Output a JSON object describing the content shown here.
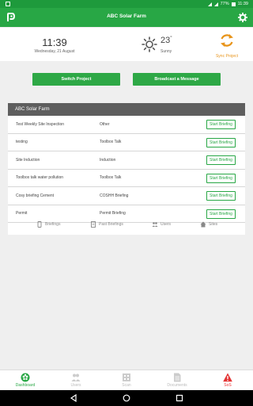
{
  "status_bar": {
    "left_icon": "app-notification-icon",
    "battery": "77%",
    "clock": "11:39"
  },
  "app_bar": {
    "title": "ABC Solar Farm",
    "logo_icon": "p-logo-icon",
    "settings_icon": "gear-icon"
  },
  "header": {
    "time": "11:39",
    "date": "Wednesday, 21 August",
    "temperature": "23",
    "temperature_unit": "°",
    "condition": "Sunny",
    "sync_label": "Sync Project",
    "weather_icon": "sun-icon",
    "sync_icon": "sync-icon"
  },
  "actions": {
    "switch_project": "Switch Project",
    "broadcast_message": "Broadcast a Message"
  },
  "panel": {
    "title": "ABC Solar Farm",
    "rows": [
      {
        "name": "Test Weekly Site Inspection",
        "type": "Other",
        "action": "Start Briefing"
      },
      {
        "name": "testing",
        "type": "Toolbox Talk",
        "action": "Start Briefing"
      },
      {
        "name": "Site Induction",
        "type": "Induction",
        "action": "Start Briefing"
      },
      {
        "name": "Toolbox talk water pollution",
        "type": "Toolbox Talk",
        "action": "Start Briefing"
      },
      {
        "name": "Cosy briefing Cement",
        "type": "COSHH Briefing",
        "action": "Start Briefing"
      },
      {
        "name": "Permit",
        "type": "Permit Briefing",
        "action": "Start Briefing"
      }
    ],
    "tabs": [
      {
        "label": "Briefings",
        "icon": "phone-icon"
      },
      {
        "label": "Past Briefings",
        "icon": "document-icon"
      },
      {
        "label": "Users",
        "icon": "users-icon"
      },
      {
        "label": "Sites",
        "icon": "home-icon"
      }
    ]
  },
  "bottom_nav": [
    {
      "label": "Dashboard",
      "icon": "dashboard-icon",
      "active": true
    },
    {
      "label": "Users",
      "icon": "users-icon",
      "active": false
    },
    {
      "label": "Scan",
      "icon": "scan-icon",
      "active": false
    },
    {
      "label": "Documents",
      "icon": "documents-icon",
      "active": false
    },
    {
      "label": "SoS",
      "icon": "warning-icon",
      "active": false
    }
  ],
  "colors": {
    "primary": "#28a745",
    "accent_sync": "#e8941a",
    "panel_header": "#5e5e5e",
    "alert": "#e33333"
  }
}
